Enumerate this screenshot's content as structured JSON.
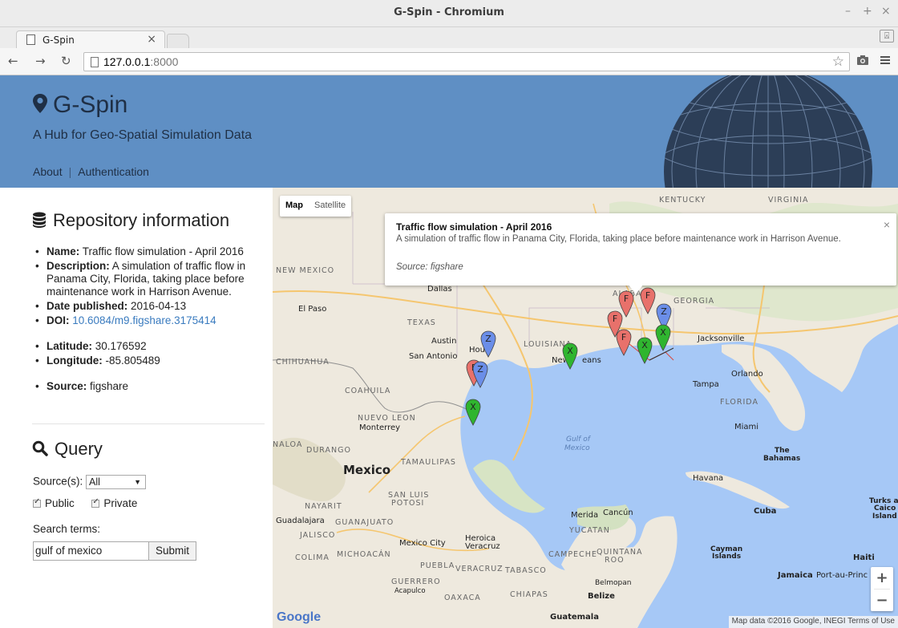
{
  "window": {
    "title": "G-Spin - Chromium",
    "controls": [
      "–",
      "+",
      "×"
    ]
  },
  "tab": {
    "label": "G-Spin",
    "close": "×"
  },
  "toolbar": {
    "back": "←",
    "forward": "→",
    "reload": "↻",
    "url_host": "127.0.0.1",
    "url_port": ":8000",
    "star": "☆"
  },
  "header": {
    "brand": "G-Spin",
    "tagline": "A Hub for Geo-Spatial Simulation Data",
    "nav": {
      "about": "About",
      "separator": "|",
      "auth": "Authentication"
    }
  },
  "repository": {
    "heading": "Repository information",
    "fields": {
      "name_label": "Name:",
      "name": "Traffic flow simulation - April 2016",
      "description_label": "Description:",
      "description": "A simulation of traffic flow in Panama City, Florida, taking place before maintenance work in Harrison Avenue.",
      "date_label": "Date published:",
      "date": "2016-04-13",
      "doi_label": "DOI:",
      "doi": "10.6084/m9.figshare.3175414",
      "latitude_label": "Latitude:",
      "latitude": "30.176592",
      "longitude_label": "Longitude:",
      "longitude": "-85.805489",
      "source_label": "Source:",
      "source": "figshare"
    }
  },
  "query": {
    "heading": "Query",
    "sources_label": "Source(s):",
    "sources_value": "All",
    "public_label": "Public",
    "private_label": "Private",
    "search_label": "Search terms:",
    "search_value": "gulf of mexico",
    "submit": "Submit"
  },
  "map": {
    "type_map": "Map",
    "type_satellite": "Satellite",
    "infowindow": {
      "title": "Traffic flow simulation - April 2016",
      "description": "A simulation of traffic flow in Panama City, Florida, taking place before maintenance work in Harrison Avenue.",
      "source": "Source: figshare",
      "close": "×"
    },
    "labels": {
      "kentucky": "KENTUCKY",
      "virginia": "VIRGINIA",
      "new_mexico": "NEW MEXICO",
      "dallas": "Dallas",
      "el_paso": "El Paso",
      "alabama": "ALABAMA",
      "georgia": "GEORGIA",
      "texas": "TEXAS",
      "austin": "Austin",
      "louisiana": "LOUISIANA",
      "jacksonville": "Jacksonville",
      "houston": "Hous",
      "san_antonio": "San Antonio",
      "new_orleans_a": "New",
      "new_orleans_b": "eans",
      "chihuahua": "CHIHUAHUA",
      "orlando": "Orlando",
      "tampa": "Tampa",
      "florida": "FLORIDA",
      "coahuila": "COAHUILA",
      "nuevo_leon": "NUEVO LEON",
      "monterrey": "Monterrey",
      "miami": "Miami",
      "gulf": "Gulf of",
      "mexico_sea": "Mexico",
      "sinaloa": "NALOA",
      "durango": "DURANGO",
      "bahamas_a": "The",
      "bahamas_b": "Bahamas",
      "mexico": "Mexico",
      "tamaulipas": "TAMAULIPAS",
      "havana": "Havana",
      "san_luis_a": "SAN LUIS",
      "san_luis_b": "POTOSI",
      "nayarit": "NAYARIT",
      "turks_a": "Turks a",
      "turks_b": "Caico",
      "turks_c": "Island",
      "cuba": "Cuba",
      "merida": "Merida",
      "cancun": "Cancún",
      "guadalajara": "Guadalajara",
      "guanajuato": "GUANAJUATO",
      "yucatan": "YUCATAN",
      "jalisco": "JALISCO",
      "heroica_a": "Heroica",
      "heroica_b": "Veracruz",
      "mexico_city": "Mexico City",
      "campeche": "CAMPECHE",
      "quintana_a": "QUINTANA",
      "quintana_b": "ROO",
      "cayman_a": "Cayman",
      "cayman_b": "Islands",
      "colima": "COLIMA",
      "michoacan": "MICHOACÁN",
      "haiti": "Haiti",
      "puebla": "PUEBLA",
      "veracruz": "VERACRUZ",
      "tabasco": "TABASCO",
      "jamaica": "Jamaica",
      "port_au_prince": "Port-au-Princ",
      "guerrero": "GUERRERO",
      "acapulco": "Acapulco",
      "belmopan": "Belmopan",
      "oaxaca": "OAXACA",
      "chiapas": "CHIAPAS",
      "belize": "Belize",
      "guatemala": "Guatemala"
    },
    "zoom_in": "+",
    "zoom_out": "−",
    "google": "Google",
    "attribution": "Map data ©2016 Google, INEGI   Terms of Use",
    "marker_colors": {
      "F": "#e8716b",
      "Z": "#6b8ee8",
      "X": "#2fb52f"
    }
  }
}
